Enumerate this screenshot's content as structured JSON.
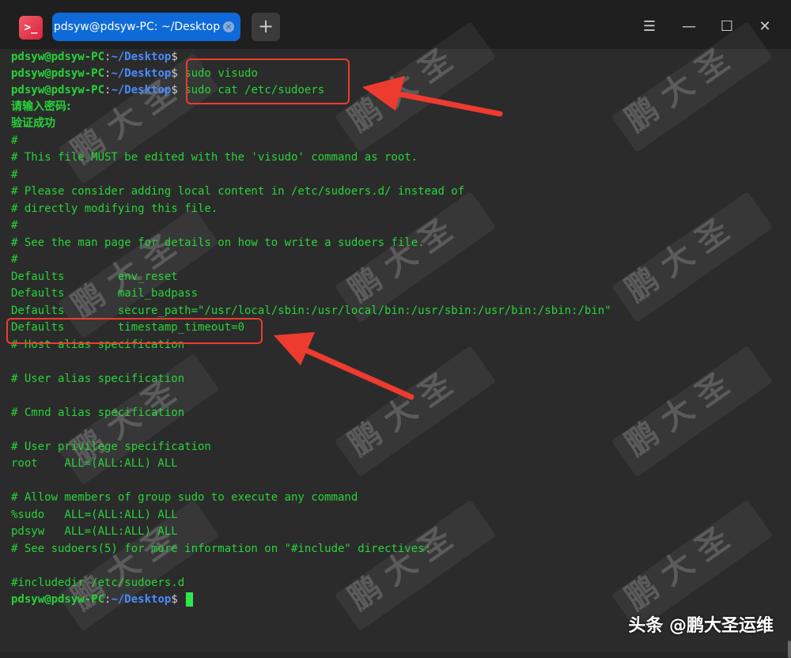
{
  "titlebar": {
    "app_icon_glyph": ">_",
    "tab_title": "pdsyw@pdsyw-PC: ~/Desktop",
    "tab_close": "×",
    "new_tab": "+",
    "menu": "☰",
    "minimize": "—",
    "maximize": "☐",
    "close": "✕"
  },
  "prompt": {
    "user_host": "pdsyw@pdsyw-PC",
    "separator": ":",
    "path": "~/Desktop",
    "symbol": "$"
  },
  "commands": {
    "first": "",
    "visudo": "sudo visudo",
    "cat": "sudo cat /etc/sudoers"
  },
  "output": [
    "请输入密码:",
    "验证成功",
    "#",
    "# This file MUST be edited with the 'visudo' command as root.",
    "#",
    "# Please consider adding local content in /etc/sudoers.d/ instead of",
    "# directly modifying this file.",
    "#",
    "# See the man page for details on how to write a sudoers file.",
    "#",
    "Defaults        env_reset",
    "Defaults        mail_badpass",
    "Defaults        secure_path=\"/usr/local/sbin:/usr/local/bin:/usr/sbin:/usr/bin:/sbin:/bin\"",
    "Defaults        timestamp_timeout=0",
    "# Host alias specification",
    "",
    "# User alias specification",
    "",
    "# Cmnd alias specification",
    "",
    "# User privilege specification",
    "root    ALL=(ALL:ALL) ALL",
    "",
    "# Allow members of group sudo to execute any command",
    "%sudo   ALL=(ALL:ALL) ALL",
    "pdsyw   ALL=(ALL:ALL) ALL",
    "# See sudoers(5) for more information on \"#include\" directives:",
    "",
    "#includedir /etc/sudoers.d"
  ],
  "watermark_text": "鹏 大 圣",
  "brand": "头条 @鹏大圣运维",
  "colors": {
    "terminal_green": "#28d33a",
    "prompt_path_blue": "#4a8cff",
    "annotation_red": "#ee3b2f",
    "tab_blue": "#0e6ad8"
  }
}
